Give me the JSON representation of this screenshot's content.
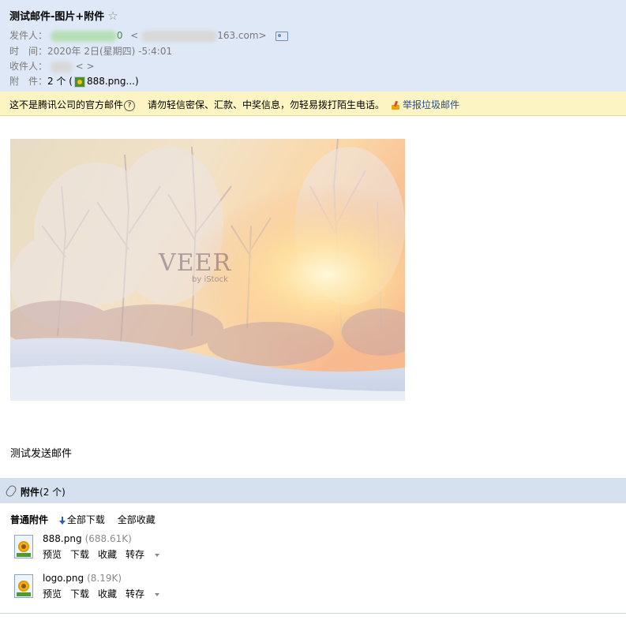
{
  "header": {
    "subject": "测试邮件-图片+附件",
    "star": "☆",
    "from_label": "发件人：",
    "from_name_visible": "0",
    "from_email_visible": "163.com>",
    "time_label": "时　间：",
    "time_value": "2020年  2日(星期四)  -5:4:01",
    "to_label": "收件人：",
    "to_visible": "<  >",
    "att_label": "附　件：",
    "att_count": "2 个 (",
    "att_first": "888.png...)"
  },
  "warning": {
    "text1": "这不是腾讯公司的官方邮件",
    "text2": "请勿轻信密保、汇款、中奖信息，勿轻易拨打陌生电话。",
    "report": "举报垃圾邮件"
  },
  "photo": {
    "watermark": "VEER",
    "watermark_sub": "by iStock"
  },
  "body": {
    "text": "测试发送邮件"
  },
  "attachments": {
    "title": "附件",
    "count": "(2 个)",
    "section_label": "普通附件",
    "download_all": "全部下载",
    "save_all": "全部收藏",
    "items": [
      {
        "name": "888.png",
        "size": "(688.61K)",
        "preview": "预览",
        "download": "下载",
        "save": "收藏",
        "forward": "转存"
      },
      {
        "name": "logo.png",
        "size": "(8.19K)",
        "preview": "预览",
        "download": "下载",
        "save": "收藏",
        "forward": "转存"
      }
    ]
  },
  "colors": {
    "header_bg": "#dfe8f6",
    "warning_bg": "#fdf4c3",
    "attachment_bar_bg": "#d6e1f0"
  }
}
